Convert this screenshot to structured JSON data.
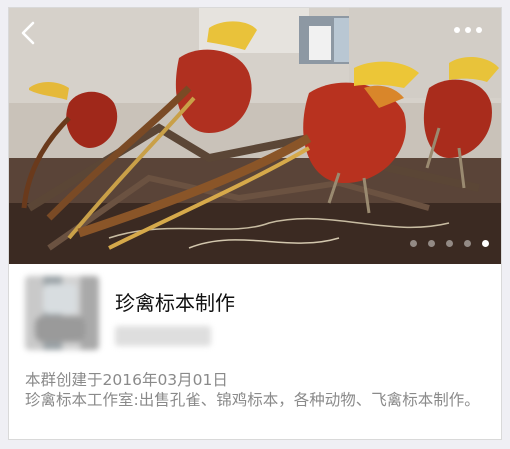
{
  "group": {
    "title": "珍禽标本制作",
    "created_text": "本群创建于2016年03月01日",
    "description": "珍禽标本工作室:出售孔雀、锦鸡标本，各种动物、飞禽标本制作。"
  },
  "carousel": {
    "image_subject": "golden-pheasant-specimens",
    "page_count": 5,
    "active_index": 4
  },
  "icons": {
    "back": "chevron-left-icon",
    "more": "more-dots-icon"
  },
  "colors": {
    "title_text": "#111111",
    "secondary_text": "#8a8a8a",
    "card_bg": "#ffffff",
    "page_bg": "#efeff4"
  }
}
